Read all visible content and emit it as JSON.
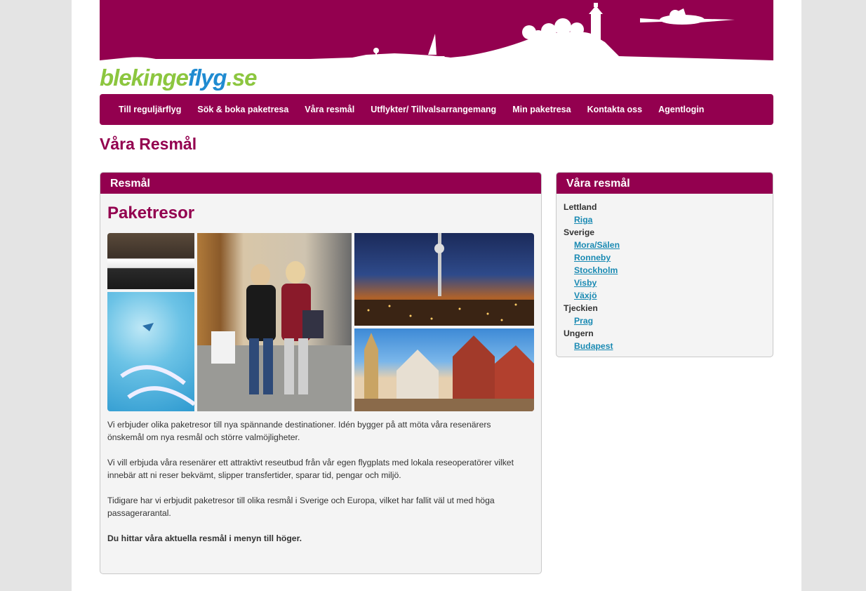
{
  "site": {
    "logo_part1": "blekinge",
    "logo_part2": "flyg",
    "logo_part3": ".se",
    "brand_color": "#93004f",
    "logo_green": "#8cc63f",
    "logo_blue": "#1f8bd1"
  },
  "nav": {
    "items": [
      "Till reguljärflyg",
      "Sök & boka paketresa",
      "Våra resmål",
      "Utflykter/ Tillvalsarrangemang",
      "Min paketresa",
      "Kontakta oss",
      "Agentlogin"
    ]
  },
  "page": {
    "title": "Våra Resmål"
  },
  "main": {
    "panel_title": "Resmål",
    "heading": "Paketresor",
    "paragraphs": [
      "Vi erbjuder olika paketresor till nya spännande destinationer. Idén bygger på att möta våra resenärers önskemål om nya resmål och större valmöjligheter.",
      "Vi vill erbjuda våra resenärer ett attraktivt reseutbud från vår egen flygplats med lokala reseoperatörer vilket innebär att ni reser bekvämt, slipper transfertider, sparar tid, pengar och miljö.",
      "Tidigare har vi erbjudit paketresor till olika resmål i Sverige och Europa, vilket har fallit väl ut med höga passagerarantal.",
      "Du hittar våra aktuella resmål i menyn till höger."
    ]
  },
  "sidebar": {
    "panel_title": "Våra resmål",
    "countries": [
      {
        "name": "Lettland",
        "cities": [
          "Riga"
        ]
      },
      {
        "name": "Sverige",
        "cities": [
          "Mora/Sälen",
          "Ronneby",
          "Stockholm",
          "Visby",
          "Växjö"
        ]
      },
      {
        "name": "Tjeckien",
        "cities": [
          "Prag"
        ]
      },
      {
        "name": "Ungern",
        "cities": [
          "Budapest"
        ]
      }
    ]
  }
}
